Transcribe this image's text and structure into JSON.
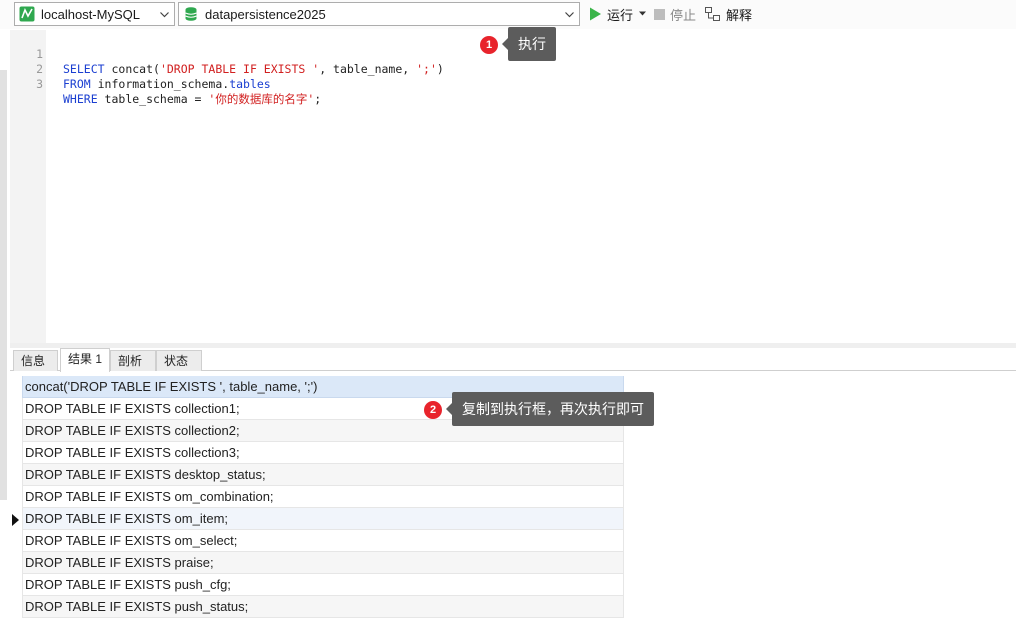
{
  "toolbar": {
    "connection": "localhost-MySQL",
    "database": "datapersistence2025",
    "run_label": "运行",
    "stop_label": "停止",
    "explain_label": "解释",
    "colors": {
      "run": "#3bb54a",
      "db_icon": "#2fa84f",
      "conn_icon": "#2fa84f"
    }
  },
  "editor": {
    "line_numbers": [
      "1",
      "2",
      "3"
    ],
    "line1": {
      "kw1": "SELECT",
      "p1": " concat(",
      "s1": "'DROP TABLE IF EXISTS '",
      "p2": ", table_name, ",
      "s2": "';'",
      "p3": ")"
    },
    "line2": {
      "kw1": "FROM",
      "p1": " information_schema.",
      "kw2": "tables"
    },
    "line3": {
      "kw1": "WHERE",
      "p1": " table_schema = ",
      "s1": "'你的数据库的名字'",
      "p2": ";"
    }
  },
  "callouts": [
    {
      "number": "1",
      "text": "执行"
    },
    {
      "number": "2",
      "text": "复制到执行框，再次执行即可"
    }
  ],
  "result_tabs": [
    "信息",
    "结果 1",
    "剖析",
    "状态"
  ],
  "results": {
    "column": "concat('DROP TABLE IF EXISTS ', table_name, ';')",
    "rows": [
      "DROP TABLE IF EXISTS collection1;",
      "DROP TABLE IF EXISTS collection2;",
      "DROP TABLE IF EXISTS collection3;",
      "DROP TABLE IF EXISTS desktop_status;",
      "DROP TABLE IF EXISTS om_combination;",
      "DROP TABLE IF EXISTS om_item;",
      "DROP TABLE IF EXISTS om_select;",
      "DROP TABLE IF EXISTS praise;",
      "DROP TABLE IF EXISTS push_cfg;",
      "DROP TABLE IF EXISTS push_status;"
    ],
    "current_row_index": 5
  }
}
